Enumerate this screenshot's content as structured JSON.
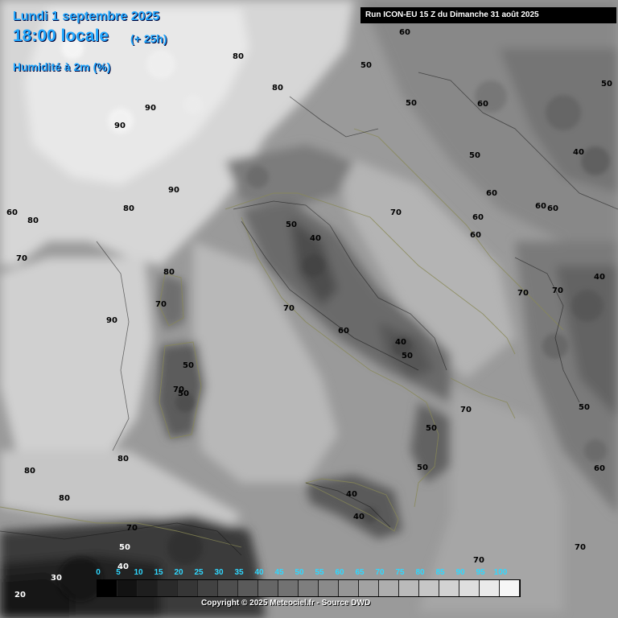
{
  "header": {
    "date": "Lundi 1 septembre 2025",
    "time": "18:00 locale",
    "lead": "(+ 25h)",
    "parameter": "Humidité à 2m (%)",
    "run": "Run ICON-EU 15 Z du Dimanche 31 août 2025"
  },
  "legend": {
    "labels": [
      "0",
      "5",
      "10",
      "15",
      "20",
      "25",
      "30",
      "35",
      "40",
      "45",
      "50",
      "55",
      "60",
      "65",
      "70",
      "75",
      "80",
      "85",
      "90",
      "95",
      "100"
    ],
    "colors": [
      "#000000",
      "#121212",
      "#1e1e1e",
      "#2a2a2a",
      "#363636",
      "#424242",
      "#4e4e4e",
      "#5a5a5a",
      "#666666",
      "#727272",
      "#7e7e7e",
      "#8a8a8a",
      "#969696",
      "#a2a2a2",
      "#aeaeae",
      "#bababa",
      "#c6c6c6",
      "#d2d2d2",
      "#dedede",
      "#eaeaea",
      "#f6f6f6"
    ],
    "label_color": "#2fd8ff"
  },
  "contour_labels": [
    {
      "text": "60",
      "id": "iso-60-a"
    },
    {
      "text": "50",
      "id": "iso-50-a"
    },
    {
      "text": "50",
      "id": "iso-50-b"
    },
    {
      "text": "60",
      "id": "iso-60-b"
    },
    {
      "text": "80",
      "id": "iso-80-a"
    },
    {
      "text": "90",
      "id": "iso-90-a"
    },
    {
      "text": "90",
      "id": "iso-90-b"
    },
    {
      "text": "80",
      "id": "iso-80-b"
    },
    {
      "text": "90",
      "id": "iso-90-c"
    },
    {
      "text": "50",
      "id": "iso-50-c"
    },
    {
      "text": "40",
      "id": "iso-40-a"
    },
    {
      "text": "60",
      "id": "iso-60-c"
    },
    {
      "text": "60",
      "id": "iso-60-d"
    },
    {
      "text": "60",
      "id": "iso-60-e"
    },
    {
      "text": "60",
      "id": "iso-60-f"
    },
    {
      "text": "70",
      "id": "iso-70-a"
    },
    {
      "text": "60",
      "id": "iso-60-g"
    },
    {
      "text": "80",
      "id": "iso-80-c"
    },
    {
      "text": "80",
      "id": "iso-80-d"
    },
    {
      "text": "50",
      "id": "iso-50-d"
    },
    {
      "text": "40",
      "id": "iso-40-b"
    },
    {
      "text": "70",
      "id": "iso-70-b"
    },
    {
      "text": "80",
      "id": "iso-80-e"
    },
    {
      "text": "70",
      "id": "iso-70-c"
    },
    {
      "text": "90",
      "id": "iso-90-d"
    },
    {
      "text": "70",
      "id": "iso-70-d"
    },
    {
      "text": "60",
      "id": "iso-60-h"
    },
    {
      "text": "40",
      "id": "iso-40-c"
    },
    {
      "text": "50",
      "id": "iso-50-e"
    },
    {
      "text": "50",
      "id": "iso-50-f"
    },
    {
      "text": "70",
      "id": "iso-70-e"
    },
    {
      "text": "60",
      "id": "iso-60-i"
    },
    {
      "text": "50",
      "id": "iso-50-g"
    },
    {
      "text": "70",
      "id": "iso-70-f"
    },
    {
      "text": "50",
      "id": "iso-50-h"
    },
    {
      "text": "40",
      "id": "iso-40-d"
    },
    {
      "text": "50",
      "id": "iso-50-i"
    },
    {
      "text": "80",
      "id": "iso-80-f"
    },
    {
      "text": "80",
      "id": "iso-80-g"
    },
    {
      "text": "80",
      "id": "iso-80-h"
    },
    {
      "text": "70",
      "id": "iso-70-g"
    },
    {
      "text": "50",
      "id": "iso-50-j"
    },
    {
      "text": "40",
      "id": "iso-40-e"
    },
    {
      "text": "30",
      "id": "iso-30-a"
    },
    {
      "text": "20",
      "id": "iso-20-a"
    },
    {
      "text": "70",
      "id": "iso-70-h"
    },
    {
      "text": "70",
      "id": "iso-70-i"
    },
    {
      "text": "70",
      "id": "iso-70-j"
    },
    {
      "text": "50",
      "id": "iso-50-k"
    },
    {
      "text": "60",
      "id": "iso-60-j"
    },
    {
      "text": "50",
      "id": "iso-50-l"
    },
    {
      "text": "40",
      "id": "iso-40-f"
    },
    {
      "text": "70",
      "id": "iso-70-k"
    },
    {
      "text": "40",
      "id": "iso-40-g"
    }
  ],
  "copyright": "Copyright © 2025 Meteociel.fr - Source DWD"
}
